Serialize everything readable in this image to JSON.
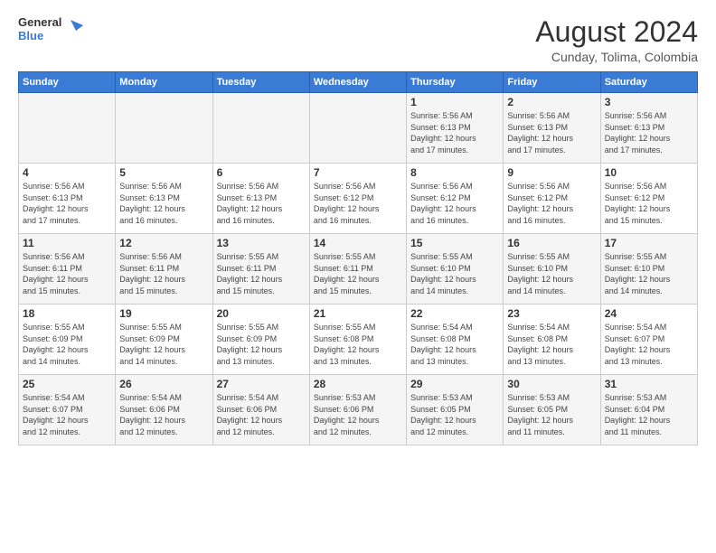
{
  "logo": {
    "line1": "General",
    "line2": "Blue"
  },
  "title": {
    "month_year": "August 2024",
    "location": "Cunday, Tolima, Colombia"
  },
  "days_of_week": [
    "Sunday",
    "Monday",
    "Tuesday",
    "Wednesday",
    "Thursday",
    "Friday",
    "Saturday"
  ],
  "weeks": [
    [
      {
        "day": "",
        "info": ""
      },
      {
        "day": "",
        "info": ""
      },
      {
        "day": "",
        "info": ""
      },
      {
        "day": "",
        "info": ""
      },
      {
        "day": "1",
        "info": "Sunrise: 5:56 AM\nSunset: 6:13 PM\nDaylight: 12 hours\nand 17 minutes."
      },
      {
        "day": "2",
        "info": "Sunrise: 5:56 AM\nSunset: 6:13 PM\nDaylight: 12 hours\nand 17 minutes."
      },
      {
        "day": "3",
        "info": "Sunrise: 5:56 AM\nSunset: 6:13 PM\nDaylight: 12 hours\nand 17 minutes."
      }
    ],
    [
      {
        "day": "4",
        "info": "Sunrise: 5:56 AM\nSunset: 6:13 PM\nDaylight: 12 hours\nand 17 minutes."
      },
      {
        "day": "5",
        "info": "Sunrise: 5:56 AM\nSunset: 6:13 PM\nDaylight: 12 hours\nand 16 minutes."
      },
      {
        "day": "6",
        "info": "Sunrise: 5:56 AM\nSunset: 6:13 PM\nDaylight: 12 hours\nand 16 minutes."
      },
      {
        "day": "7",
        "info": "Sunrise: 5:56 AM\nSunset: 6:12 PM\nDaylight: 12 hours\nand 16 minutes."
      },
      {
        "day": "8",
        "info": "Sunrise: 5:56 AM\nSunset: 6:12 PM\nDaylight: 12 hours\nand 16 minutes."
      },
      {
        "day": "9",
        "info": "Sunrise: 5:56 AM\nSunset: 6:12 PM\nDaylight: 12 hours\nand 16 minutes."
      },
      {
        "day": "10",
        "info": "Sunrise: 5:56 AM\nSunset: 6:12 PM\nDaylight: 12 hours\nand 15 minutes."
      }
    ],
    [
      {
        "day": "11",
        "info": "Sunrise: 5:56 AM\nSunset: 6:11 PM\nDaylight: 12 hours\nand 15 minutes."
      },
      {
        "day": "12",
        "info": "Sunrise: 5:56 AM\nSunset: 6:11 PM\nDaylight: 12 hours\nand 15 minutes."
      },
      {
        "day": "13",
        "info": "Sunrise: 5:55 AM\nSunset: 6:11 PM\nDaylight: 12 hours\nand 15 minutes."
      },
      {
        "day": "14",
        "info": "Sunrise: 5:55 AM\nSunset: 6:11 PM\nDaylight: 12 hours\nand 15 minutes."
      },
      {
        "day": "15",
        "info": "Sunrise: 5:55 AM\nSunset: 6:10 PM\nDaylight: 12 hours\nand 14 minutes."
      },
      {
        "day": "16",
        "info": "Sunrise: 5:55 AM\nSunset: 6:10 PM\nDaylight: 12 hours\nand 14 minutes."
      },
      {
        "day": "17",
        "info": "Sunrise: 5:55 AM\nSunset: 6:10 PM\nDaylight: 12 hours\nand 14 minutes."
      }
    ],
    [
      {
        "day": "18",
        "info": "Sunrise: 5:55 AM\nSunset: 6:09 PM\nDaylight: 12 hours\nand 14 minutes."
      },
      {
        "day": "19",
        "info": "Sunrise: 5:55 AM\nSunset: 6:09 PM\nDaylight: 12 hours\nand 14 minutes."
      },
      {
        "day": "20",
        "info": "Sunrise: 5:55 AM\nSunset: 6:09 PM\nDaylight: 12 hours\nand 13 minutes."
      },
      {
        "day": "21",
        "info": "Sunrise: 5:55 AM\nSunset: 6:08 PM\nDaylight: 12 hours\nand 13 minutes."
      },
      {
        "day": "22",
        "info": "Sunrise: 5:54 AM\nSunset: 6:08 PM\nDaylight: 12 hours\nand 13 minutes."
      },
      {
        "day": "23",
        "info": "Sunrise: 5:54 AM\nSunset: 6:08 PM\nDaylight: 12 hours\nand 13 minutes."
      },
      {
        "day": "24",
        "info": "Sunrise: 5:54 AM\nSunset: 6:07 PM\nDaylight: 12 hours\nand 13 minutes."
      }
    ],
    [
      {
        "day": "25",
        "info": "Sunrise: 5:54 AM\nSunset: 6:07 PM\nDaylight: 12 hours\nand 12 minutes."
      },
      {
        "day": "26",
        "info": "Sunrise: 5:54 AM\nSunset: 6:06 PM\nDaylight: 12 hours\nand 12 minutes."
      },
      {
        "day": "27",
        "info": "Sunrise: 5:54 AM\nSunset: 6:06 PM\nDaylight: 12 hours\nand 12 minutes."
      },
      {
        "day": "28",
        "info": "Sunrise: 5:53 AM\nSunset: 6:06 PM\nDaylight: 12 hours\nand 12 minutes."
      },
      {
        "day": "29",
        "info": "Sunrise: 5:53 AM\nSunset: 6:05 PM\nDaylight: 12 hours\nand 12 minutes."
      },
      {
        "day": "30",
        "info": "Sunrise: 5:53 AM\nSunset: 6:05 PM\nDaylight: 12 hours\nand 11 minutes."
      },
      {
        "day": "31",
        "info": "Sunrise: 5:53 AM\nSunset: 6:04 PM\nDaylight: 12 hours\nand 11 minutes."
      }
    ]
  ]
}
